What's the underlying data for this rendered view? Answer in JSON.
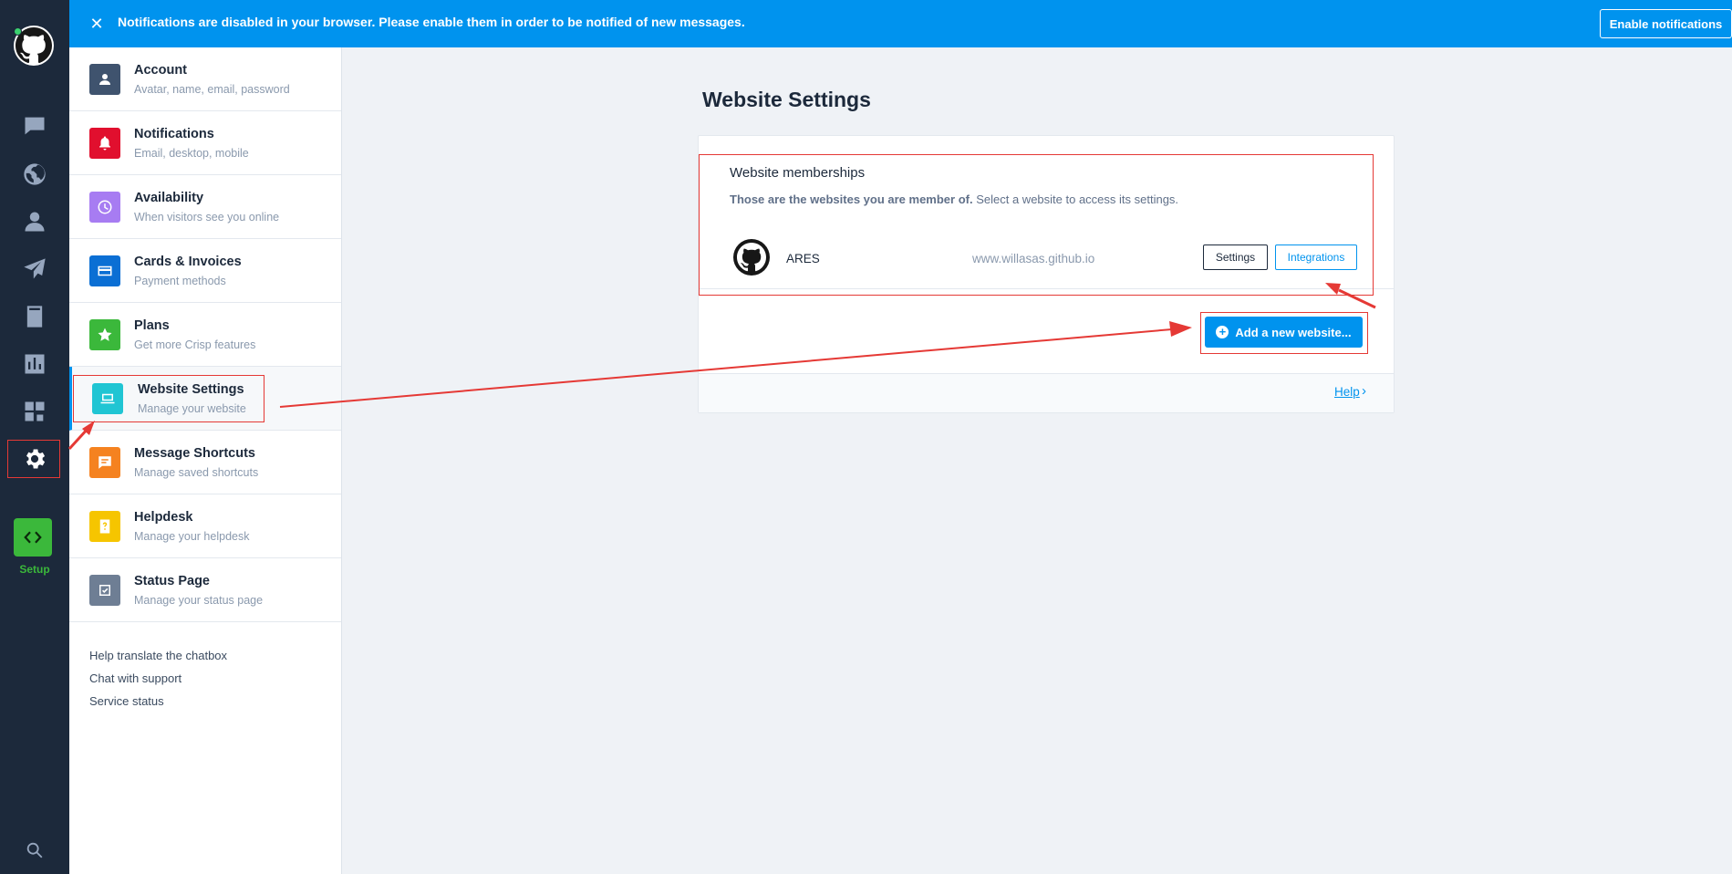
{
  "banner": {
    "message": "Notifications are disabled in your browser. Please enable them in order to be notified of new messages.",
    "enable_label": "Enable notifications",
    "close_icon": "close-icon"
  },
  "rail": {
    "items": [
      "chat-icon",
      "globe-icon",
      "user-icon",
      "send-icon",
      "book-icon",
      "analytics-icon",
      "plugins-icon",
      "gear-icon"
    ],
    "setup_label": "Setup",
    "search_icon": "search-icon"
  },
  "menu": {
    "items": [
      {
        "title": "Account",
        "subtitle": "Avatar, name, email, password",
        "color": "#3f536e",
        "icon": "user-icon"
      },
      {
        "title": "Notifications",
        "subtitle": "Email, desktop, mobile",
        "color": "#e10f2e",
        "icon": "bell-icon"
      },
      {
        "title": "Availability",
        "subtitle": "When visitors see you online",
        "color": "#a77cf2",
        "icon": "clock-icon"
      },
      {
        "title": "Cards & Invoices",
        "subtitle": "Payment methods",
        "color": "#0b6fd4",
        "icon": "card-icon"
      },
      {
        "title": "Plans",
        "subtitle": "Get more Crisp features",
        "color": "#3bb83b",
        "icon": "star-icon"
      },
      {
        "title": "Website Settings",
        "subtitle": "Manage your website",
        "color": "#20c5d3",
        "icon": "laptop-icon"
      },
      {
        "title": "Message Shortcuts",
        "subtitle": "Manage saved shortcuts",
        "color": "#f58220",
        "icon": "message-icon"
      },
      {
        "title": "Helpdesk",
        "subtitle": "Manage your helpdesk",
        "color": "#f6c500",
        "icon": "helpdesk-icon"
      },
      {
        "title": "Status Page",
        "subtitle": "Manage your status page",
        "color": "#6e7e94",
        "icon": "check-icon"
      }
    ],
    "footer_links": [
      "Help translate the chatbox",
      "Chat with support",
      "Service status"
    ]
  },
  "main": {
    "title": "Website Settings",
    "memberships": {
      "title": "Website memberships",
      "desc_bold": "Those are the websites you are member of.",
      "desc_rest": "Select a website to access its settings.",
      "website": {
        "name": "ARES",
        "domain": "www.willasas.github.io"
      },
      "settings_label": "Settings",
      "integrations_label": "Integrations"
    },
    "add_label": "Add a new website...",
    "help_label": "Help",
    "help_chevron": "›"
  },
  "colors": {
    "accent": "#0093ee",
    "rail": "#1c293b",
    "setup": "#3bb83b",
    "annotation": "#e53935"
  }
}
